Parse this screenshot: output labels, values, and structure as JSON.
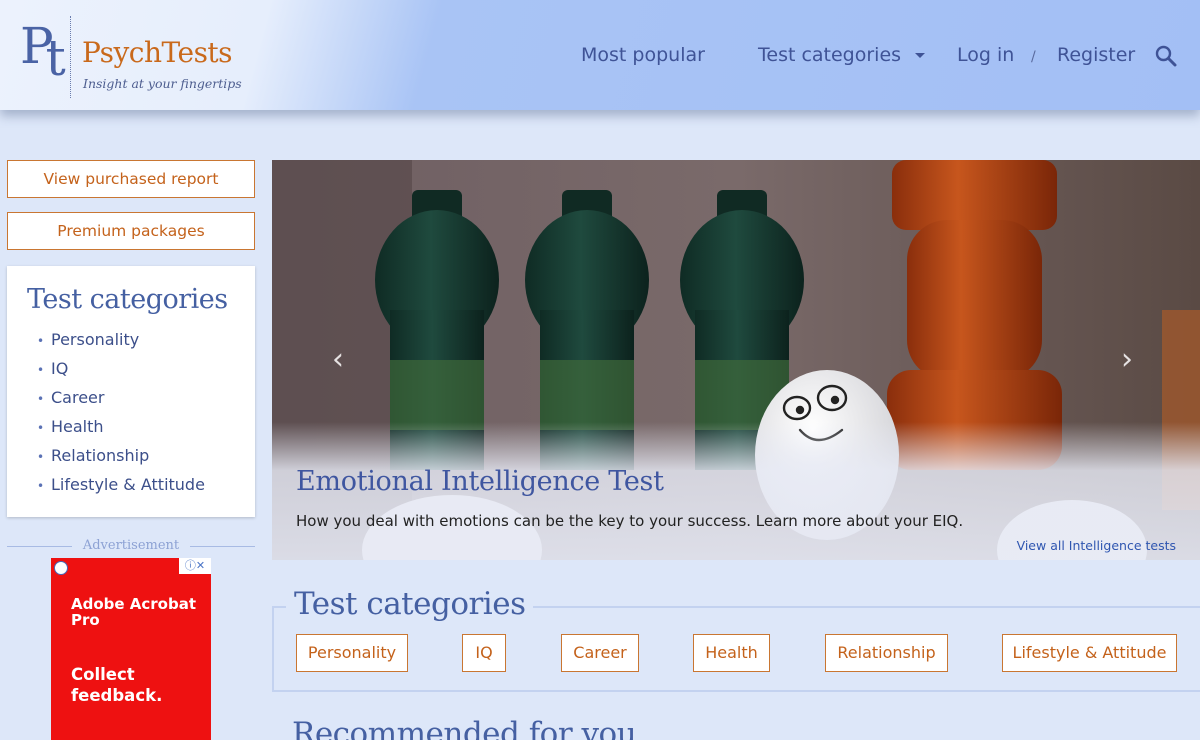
{
  "brand": {
    "mark": "Pt",
    "name": "PsychTests",
    "tagline": "Insight at your fingertips"
  },
  "nav": {
    "most_popular": "Most popular",
    "test_categories": "Test categories",
    "log_in": "Log in",
    "separator": "/",
    "register": "Register",
    "search_icon": "search-icon"
  },
  "sidebar": {
    "view_report": "View purchased report",
    "premium": "Premium packages",
    "categories_title": "Test categories",
    "categories": [
      "Personality",
      "IQ",
      "Career",
      "Health",
      "Relationship",
      "Lifestyle & Attitude"
    ],
    "ad_label": "Advertisement",
    "ad": {
      "title": "Adobe Acrobat Pro",
      "cta": "Collect feedback.",
      "color": "#ee1111"
    }
  },
  "hero": {
    "title": "Emotional Intelligence Test",
    "subtitle": "How you deal with emotions can be the key to your success. Learn more about your EIQ.",
    "link": "View all Intelligence tests",
    "prev_icon": "chevron-left-icon",
    "next_icon": "chevron-right-icon"
  },
  "categories_section": {
    "title": "Test categories",
    "items": [
      "Personality",
      "IQ",
      "Career",
      "Health",
      "Relationship",
      "Lifestyle & Attitude"
    ]
  },
  "recommended": {
    "title": "Recommended for you"
  },
  "colors": {
    "accent_orange": "#c4621b",
    "heading_blue": "#4560a2",
    "page_bg": "#dde7f9"
  }
}
